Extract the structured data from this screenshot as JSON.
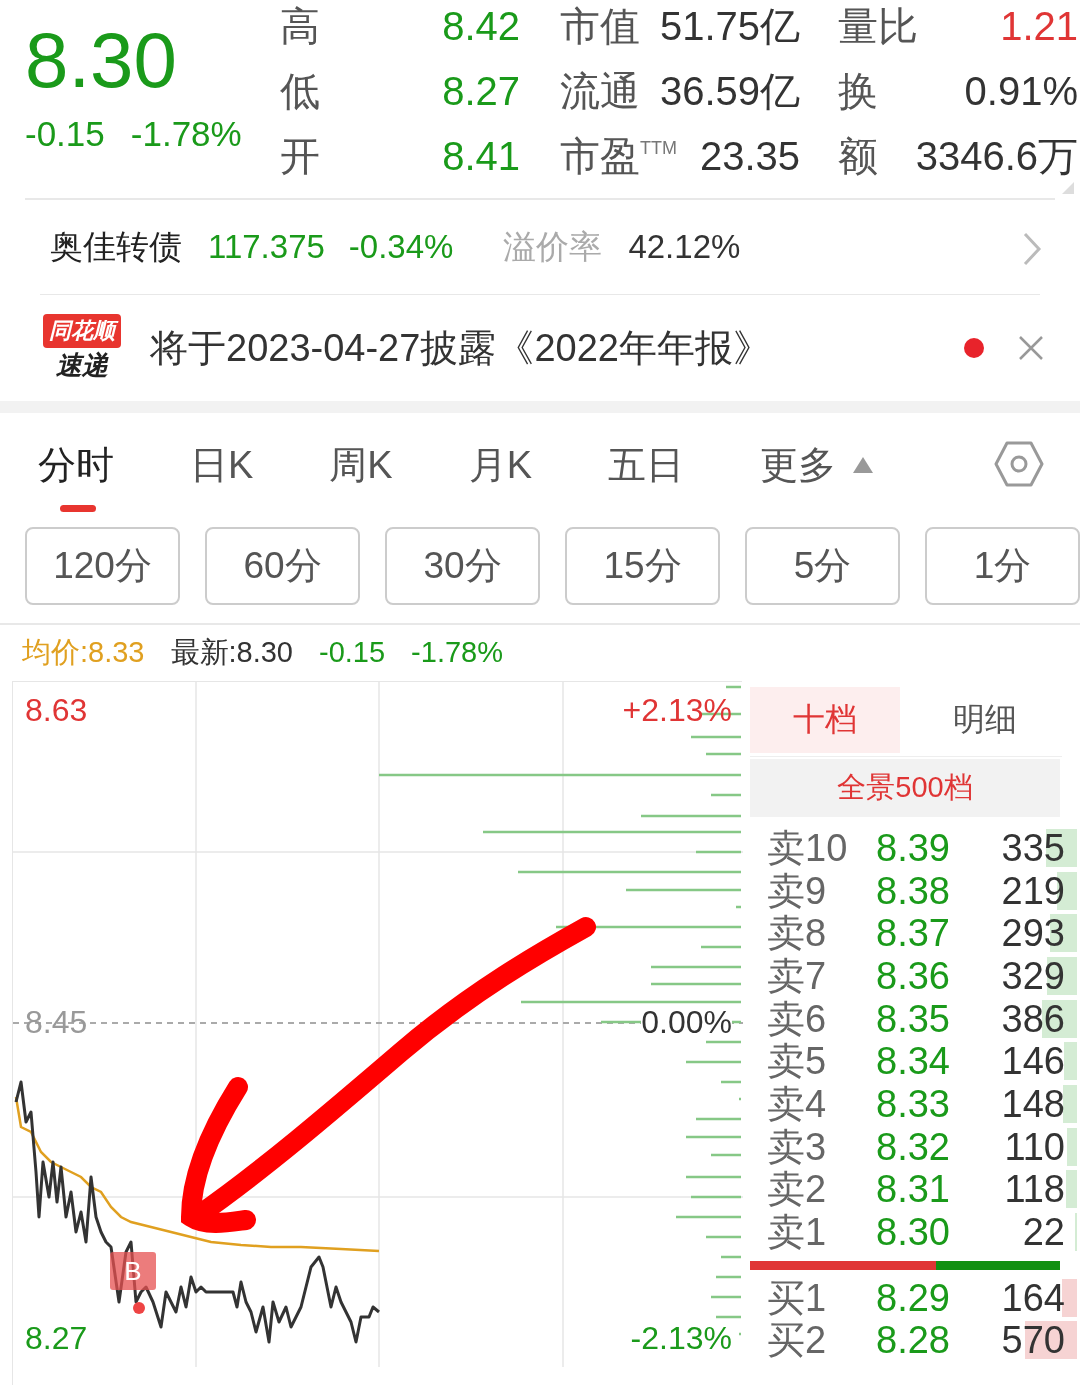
{
  "quote": {
    "price": "8.30",
    "change": "-0.15",
    "change_pct": "-1.78%"
  },
  "stats": [
    [
      {
        "label": "高",
        "value": "8.42",
        "color": "#1a9a1a"
      },
      {
        "label": "市值",
        "value": "51.75亿",
        "color": "#333333"
      },
      {
        "label": "量比",
        "value": "1.21",
        "color": "#e03535"
      }
    ],
    [
      {
        "label": "低",
        "value": "8.27",
        "color": "#1a9a1a"
      },
      {
        "label": "流通",
        "value": "36.59亿",
        "color": "#333333"
      },
      {
        "label": "换",
        "value": "0.91%",
        "color": "#333333"
      }
    ],
    [
      {
        "label": "开",
        "value": "8.41",
        "color": "#1a9a1a"
      },
      {
        "label": "市盈$^{TTM}$",
        "value": "23.35",
        "color": "#333333"
      },
      {
        "label": "额",
        "value": "3346.6万",
        "color": "#333333"
      }
    ]
  ],
  "bond": {
    "name": "奥佳转债",
    "price": "117.375",
    "change_pct": "-0.34%",
    "premium_label": "溢价率",
    "premium": "42.12%"
  },
  "news": {
    "logo_top": "同花顺",
    "logo_bottom": "速递",
    "text": "将于2023-04-27披露《2022年年报》",
    "unread": true
  },
  "tabs": [
    {
      "label": "分时",
      "selected": true,
      "kind": "tab"
    },
    {
      "label": "日K",
      "selected": false,
      "kind": "tab"
    },
    {
      "label": "周K",
      "selected": false,
      "kind": "tab"
    },
    {
      "label": "月K",
      "selected": false,
      "kind": "tab"
    },
    {
      "label": "五日",
      "selected": false,
      "kind": "tab"
    },
    {
      "label": "更多",
      "selected": false,
      "kind": "menu"
    }
  ],
  "periods": [
    "120分",
    "60分",
    "30分",
    "15分",
    "5分",
    "1分"
  ],
  "info": {
    "average": "均价:8.33",
    "latest": "最新:8.30",
    "change": "-0.15",
    "change_pct": "-1.78%"
  },
  "chart": {
    "high": "8.63",
    "high_pct": "+2.13%",
    "base": "8.45",
    "base_pct": "0.00%",
    "low": "8.27",
    "low_pct": "-2.13%",
    "marker": "B"
  },
  "order_book": {
    "tabs": [
      {
        "label": "十档",
        "selected": true
      },
      {
        "label": "明细",
        "selected": false
      }
    ],
    "panorama": "全景500档",
    "asks": [
      {
        "label": "卖10",
        "price": "8.39",
        "volume": "335"
      },
      {
        "label": "卖9",
        "price": "8.38",
        "volume": "219"
      },
      {
        "label": "卖8",
        "price": "8.37",
        "volume": "293"
      },
      {
        "label": "卖7",
        "price": "8.36",
        "volume": "329"
      },
      {
        "label": "卖6",
        "price": "8.35",
        "volume": "386"
      },
      {
        "label": "卖5",
        "price": "8.34",
        "volume": "146"
      },
      {
        "label": "卖4",
        "price": "8.33",
        "volume": "148"
      },
      {
        "label": "卖3",
        "price": "8.32",
        "volume": "110"
      },
      {
        "label": "卖2",
        "price": "8.31",
        "volume": "118"
      },
      {
        "label": "卖1",
        "price": "8.30",
        "volume": "22"
      }
    ],
    "balance": {
      "level": 0.6
    },
    "bids": [
      {
        "label": "买1",
        "price": "8.29",
        "volume": "164"
      },
      {
        "label": "买2",
        "price": "8.28",
        "volume": "570"
      }
    ]
  }
}
